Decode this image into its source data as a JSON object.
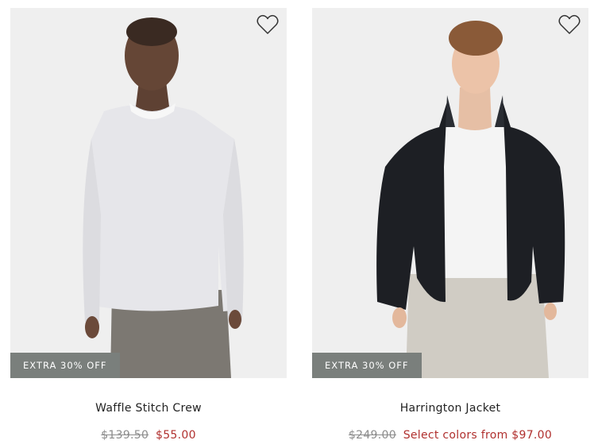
{
  "products": [
    {
      "name": "Waffle Stitch Crew",
      "badge": "EXTRA 30% OFF",
      "original_price": "$139.50",
      "sale_price": "$55.00",
      "wishlist_icon": "heart-outline-icon",
      "image": "product-photo-model-light-sweater"
    },
    {
      "name": "Harrington Jacket",
      "badge": "EXTRA 30% OFF",
      "original_price": "$249.00",
      "sale_price": "Select colors from $97.00",
      "wishlist_icon": "heart-outline-icon",
      "image": "product-photo-model-black-jacket"
    }
  ],
  "colors": {
    "badge_bg": "#7a7f7c",
    "sale_red": "#b0302e",
    "strike_gray": "#8c8c8c",
    "photo_bg": "#efefef"
  }
}
